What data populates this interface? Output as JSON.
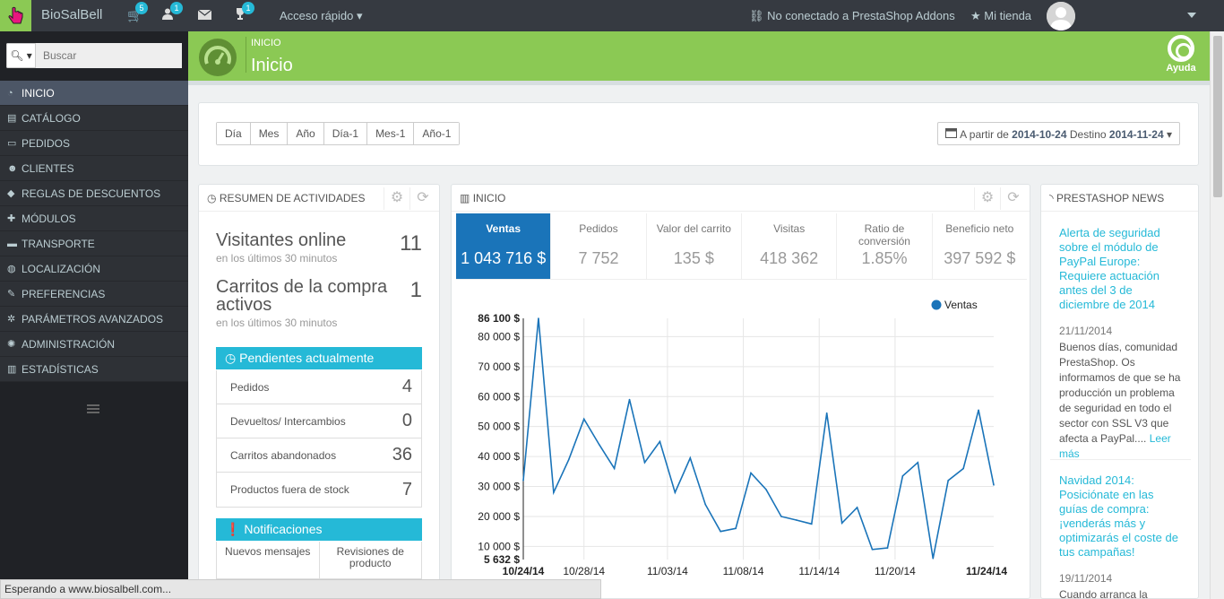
{
  "topbar": {
    "shop_name": "BioSalBell",
    "cart_badge": "5",
    "customers_badge": "1",
    "trophy_badge": "1",
    "quick_access": "Acceso rápido",
    "addons": "No conectado a PrestaShop Addons",
    "my_shop": "Mi tienda"
  },
  "search": {
    "placeholder": "Buscar"
  },
  "sidebar": {
    "items": [
      {
        "label": "INICIO",
        "icon": "dashboard-icon"
      },
      {
        "label": "CATÁLOGO",
        "icon": "book-icon"
      },
      {
        "label": "PEDIDOS",
        "icon": "credit-card-icon"
      },
      {
        "label": "CLIENTES",
        "icon": "users-icon"
      },
      {
        "label": "REGLAS DE DESCUENTOS",
        "icon": "tags-icon"
      },
      {
        "label": "MÓDULOS",
        "icon": "puzzle-icon"
      },
      {
        "label": "TRANSPORTE",
        "icon": "truck-icon"
      },
      {
        "label": "LOCALIZACIÓN",
        "icon": "globe-icon"
      },
      {
        "label": "PREFERENCIAS",
        "icon": "wrench-icon"
      },
      {
        "label": "PARÁMETROS AVANZADOS",
        "icon": "cogs-icon"
      },
      {
        "label": "ADMINISTRACIÓN",
        "icon": "cog-icon"
      },
      {
        "label": "ESTADÍSTICAS",
        "icon": "bar-chart-icon"
      }
    ]
  },
  "header": {
    "breadcrumb": "INICIO",
    "title": "Inicio",
    "help": "Ayuda"
  },
  "toolbar": {
    "periods": [
      "Día",
      "Mes",
      "Año",
      "Día-1",
      "Mes-1",
      "Año-1"
    ],
    "from_label": "A partir de",
    "from": "2014-10-24",
    "to_label": "Destino",
    "to": "2014-11-24"
  },
  "activity": {
    "title": "RESUMEN DE ACTIVIDADES",
    "visitors_label": "Visitantes online",
    "visitors_value": "11",
    "visitors_sub": "en los últimos 30 minutos",
    "carts_label": "Carritos de la compra activos",
    "carts_value": "1",
    "carts_sub": "en los últimos 30 minutos",
    "pending_title": "Pendientes actualmente",
    "pending": [
      {
        "label": "Pedidos",
        "value": "4"
      },
      {
        "label": "Devueltos/ Intercambios",
        "value": "0"
      },
      {
        "label": "Carritos abandonados",
        "value": "36"
      },
      {
        "label": "Productos fuera de stock",
        "value": "7"
      }
    ],
    "notif_title": "Notificaciones",
    "notif_tabs": [
      "Nuevos mensajes",
      "Revisiones de producto"
    ]
  },
  "inicio": {
    "title": "INICIO",
    "kpis": [
      {
        "label": "Ventas",
        "value": "1 043 716 $"
      },
      {
        "label": "Pedidos",
        "value": "7 752"
      },
      {
        "label": "Valor del carrito",
        "value": "135 $"
      },
      {
        "label": "Visitas",
        "value": "418 362"
      },
      {
        "label": "Ratio de conversión",
        "value": "1.85%"
      },
      {
        "label": "Beneficio neto",
        "value": "397 592 $"
      }
    ]
  },
  "chart_data": {
    "type": "line",
    "series": [
      {
        "name": "Ventas",
        "color": "#1a74b9",
        "values": [
          32000,
          86100,
          28000,
          39000,
          52500,
          44000,
          36000,
          59000,
          38000,
          45000,
          28000,
          39500,
          24000,
          15000,
          16000,
          34500,
          29000,
          20000,
          18800,
          17500,
          54500,
          17800,
          23000,
          9000,
          9500,
          33500,
          38000,
          6000,
          32000,
          36000,
          55500,
          30500
        ]
      }
    ],
    "x_ticks": [
      "10/24/14",
      "10/28/14",
      "11/03/14",
      "11/08/14",
      "11/14/14",
      "11/20/14",
      "11/24/14"
    ],
    "y_ticks": [
      "86 100 $",
      "80 000 $",
      "70 000 $",
      "60 000 $",
      "50 000 $",
      "40 000 $",
      "30 000 $",
      "20 000 $",
      "10 000 $",
      "5 632 $"
    ],
    "ylim": [
      5632,
      86100
    ],
    "legend": "top-right"
  },
  "news": {
    "title": "PRESTASHOP NEWS",
    "items": [
      {
        "title": "Alerta de seguridad sobre el módulo de PayPal Europe: Requiere actuación antes del 3 de diciembre de 2014",
        "date": "21/11/2014",
        "body": "Buenos días, comunidad PrestaShop. Os informamos de que se ha producción un problema de seguridad en todo el sector con SSL V3 que afecta a PayPal....",
        "more": "Leer más"
      },
      {
        "title": "Navidad 2014: Posiciónate en las guías de compra: ¡venderás más y optimizarás el coste de tus campañas!",
        "date": "19/11/2014",
        "body": "Cuando arranca la temporada navideña,"
      }
    ]
  },
  "status": "Esperando a www.biosalbell.com..."
}
